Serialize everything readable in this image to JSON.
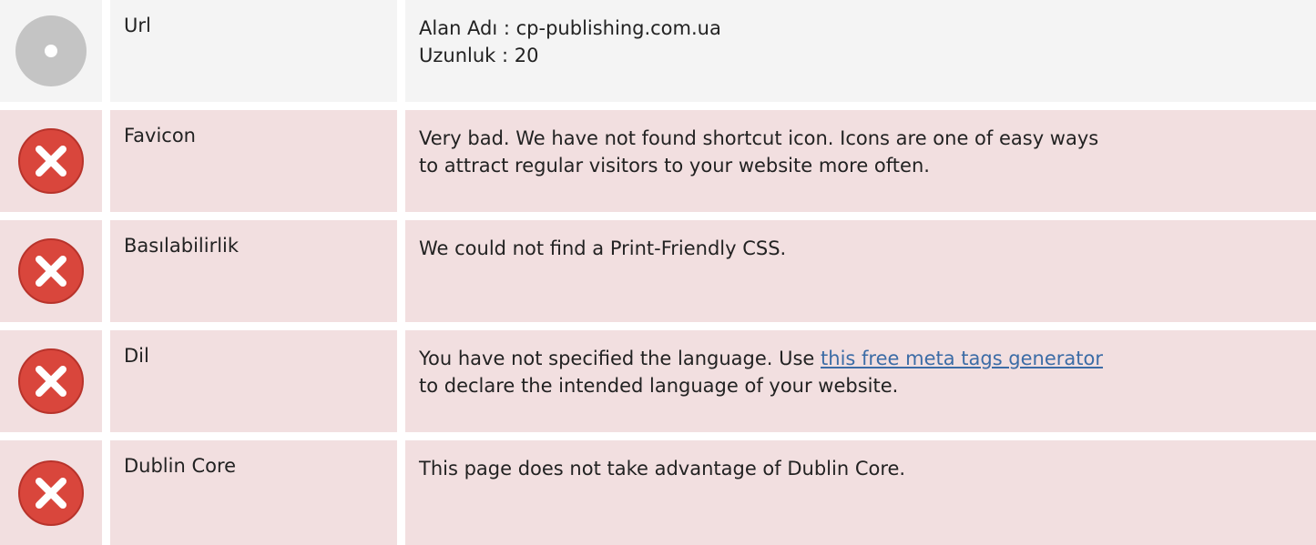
{
  "colors": {
    "neutral_row_bg": "#f4f4f4",
    "bad_row_bg": "#f2dfe0",
    "neutral_icon": "#c4c4c4",
    "bad_icon": "#d9463c",
    "link": "#3c6ca6"
  },
  "rows": [
    {
      "status": "neutral",
      "icon": "neutral-circle-icon",
      "label": "Url",
      "lines": [
        "Alan Adı : cp-publishing.com.ua",
        "Uzunluk : 20"
      ]
    },
    {
      "status": "bad",
      "icon": "error-x-icon",
      "label": "Favicon",
      "lines": [
        "Very bad. We have not found shortcut icon. Icons are one of easy ways",
        "to attract regular visitors to your website more often."
      ]
    },
    {
      "status": "bad",
      "icon": "error-x-icon",
      "label": "Basılabilirlik",
      "lines": [
        "We could not find a Print-Friendly CSS."
      ]
    },
    {
      "status": "bad",
      "icon": "error-x-icon",
      "label": "Dil",
      "line1_prefix": "You have not specified the language. Use ",
      "link_text": "this free meta tags generator",
      "line2": "to declare the intended language of your website."
    },
    {
      "status": "bad",
      "icon": "error-x-icon",
      "label": "Dublin Core",
      "lines": [
        "This page does not take advantage of Dublin Core."
      ]
    }
  ]
}
